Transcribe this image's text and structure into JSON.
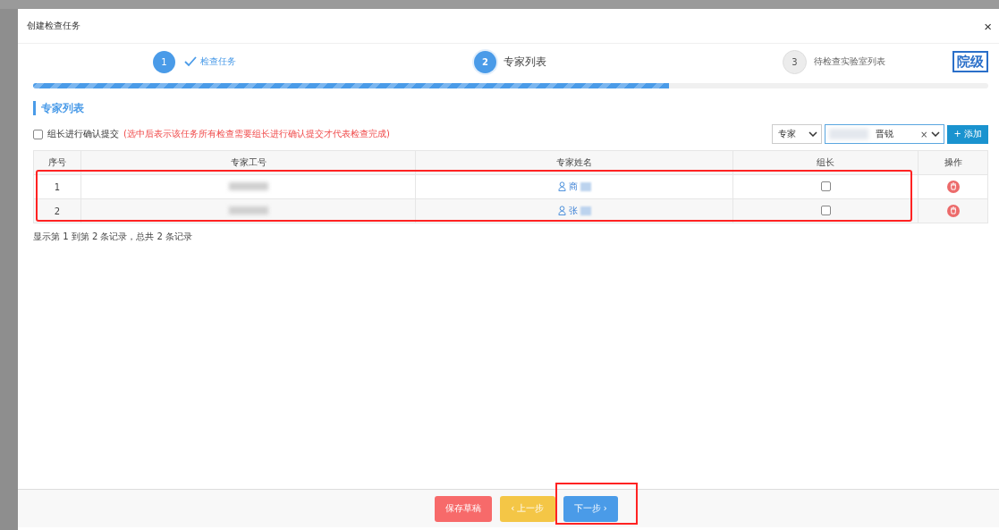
{
  "dialog": {
    "title": "创建检查任务",
    "close": "×"
  },
  "steps": [
    {
      "number": "1",
      "label": "检查任务",
      "completed": true,
      "selected": false
    },
    {
      "number": "2",
      "label": "专家列表",
      "completed": false,
      "selected": true
    },
    {
      "number": "3",
      "label": "待检查实验室列表",
      "completed": false,
      "selected": false
    }
  ],
  "level_badge": "院级",
  "progress": {
    "level": 0.666
  },
  "section_title": "专家列表",
  "leader_confirm": {
    "label": "组长进行确认提交",
    "note": "(选中后表示该任务所有检查需要组长进行确认提交才代表检查完成)",
    "checked": false
  },
  "role_select": {
    "value": "专家"
  },
  "expert_select": {
    "value": "晋锐",
    "clear": "×"
  },
  "add_button": "+ 添加",
  "table": {
    "columns": [
      "序号",
      "专家工号",
      "专家姓名",
      "组长",
      "操作"
    ],
    "rows": [
      {
        "index": "1",
        "name": "商",
        "leader": false
      },
      {
        "index": "2",
        "name": "张",
        "leader": false
      }
    ]
  },
  "pagination_info": "显示第 1 到第 2 条记录，总共 2 条记录",
  "buttons": [
    {
      "label": "保存草稿",
      "kind": "danger"
    },
    {
      "label": "‹ 上一步",
      "kind": "warning"
    },
    {
      "label": "下一步 ›",
      "kind": "primary"
    }
  ]
}
